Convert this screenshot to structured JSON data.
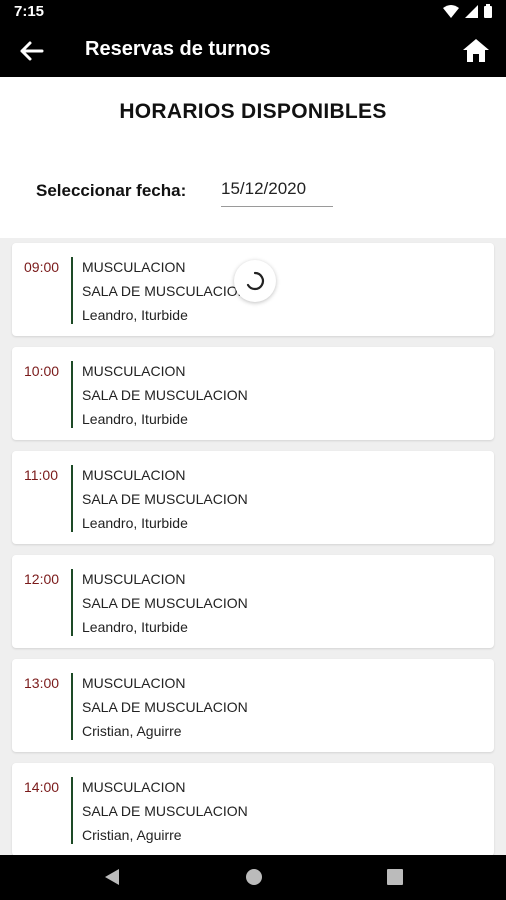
{
  "status_bar": {
    "time": "7:15"
  },
  "app_bar": {
    "title": "Reservas de turnos",
    "back_icon": "arrow-left-icon",
    "home_icon": "home-icon"
  },
  "header": {
    "title": "HORARIOS DISPONIBLES",
    "date_label": "Seleccionar fecha:",
    "date_value": "15/12/2020"
  },
  "colors": {
    "app_bar": "#000000",
    "time_text": "#7a1a1a",
    "divider": "#1d4a26",
    "background": "#efefef"
  },
  "slots": [
    {
      "time": "09:00",
      "activity": "MUSCULACION",
      "room": "SALA DE MUSCULACION",
      "trainer": "Leandro, Iturbide"
    },
    {
      "time": "10:00",
      "activity": "MUSCULACION",
      "room": "SALA DE MUSCULACION",
      "trainer": "Leandro, Iturbide"
    },
    {
      "time": "11:00",
      "activity": "MUSCULACION",
      "room": "SALA DE MUSCULACION",
      "trainer": "Leandro, Iturbide"
    },
    {
      "time": "12:00",
      "activity": "MUSCULACION",
      "room": "SALA DE MUSCULACION",
      "trainer": "Leandro, Iturbide"
    },
    {
      "time": "13:00",
      "activity": "MUSCULACION",
      "room": "SALA DE MUSCULACION",
      "trainer": "Cristian, Aguirre"
    },
    {
      "time": "14:00",
      "activity": "MUSCULACION",
      "room": "SALA DE MUSCULACION",
      "trainer": "Cristian, Aguirre"
    }
  ]
}
